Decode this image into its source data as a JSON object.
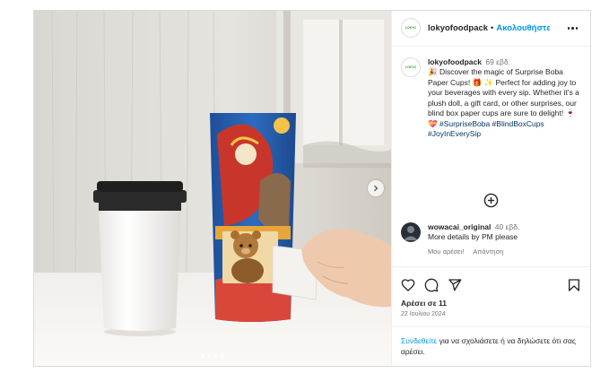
{
  "post": {
    "username": "lokyofoodpack",
    "follow_label": "Ακολουθήστε",
    "separator": "•",
    "avatar_text": "LOKYO",
    "caption": {
      "time": "69 εβδ.",
      "text": "🎉 Discover the magic of Surprise Boba Paper Cups! 🎁 ✨ Perfect for adding joy to your beverages with every sip. Whether it's a plush doll, a gift card, or other surprises, our blind box paper cups are sure to delight! 🍷 💝",
      "tags": "#SurpriseBoba #BlindBoxCups #JoyInEverySip"
    },
    "comments": [
      {
        "username": "wowacai_original",
        "time": "40 εβδ.",
        "text": "More details by PM please",
        "like_label": "Μου αρέσει!",
        "reply_label": "Απάντηση"
      }
    ],
    "likes": "Αρέσει σε 11",
    "date": "22 Ιουλίου 2024",
    "login_prompt": {
      "link": "Συνδεθείτε",
      "text": " για να σχολιάσετε ή να δηλώσετε ότι σας αρέσει."
    }
  },
  "carousel": {
    "slide_count": 4,
    "active_index": 0
  },
  "icons": [
    "more-icon",
    "heart-icon",
    "comment-icon",
    "share-icon",
    "bookmark-icon",
    "add-comment-icon",
    "next-arrow-icon"
  ],
  "colors": {
    "link": "#0095f6",
    "tag": "#00376b",
    "border": "#dbdbdb",
    "muted": "#737373"
  }
}
